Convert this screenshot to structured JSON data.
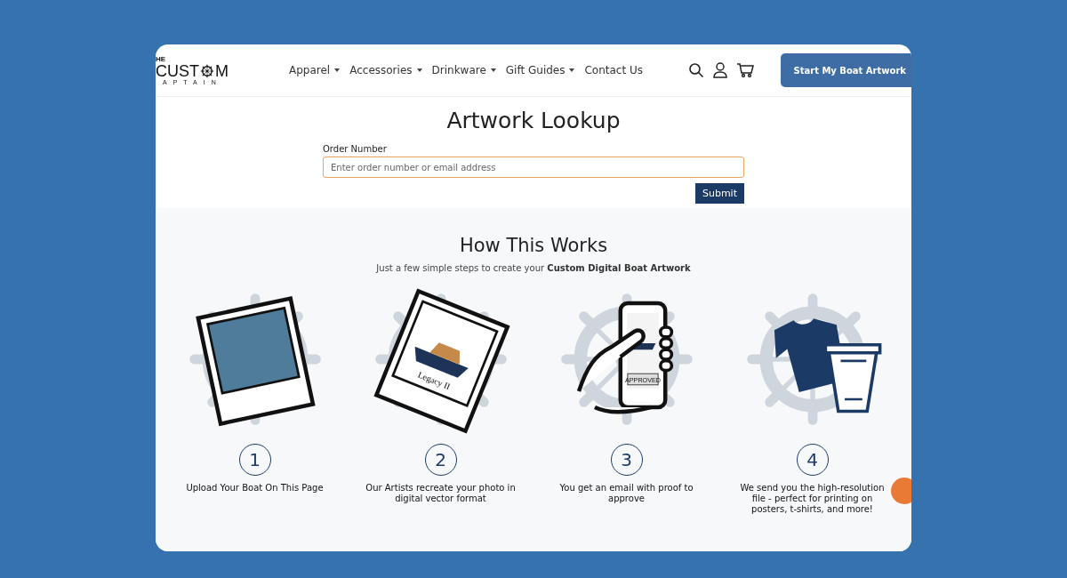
{
  "header": {
    "logo": {
      "top": "HE",
      "left": "CUST",
      "right": "M",
      "bottom": "APTAIN"
    },
    "nav": [
      {
        "label": "Apparel",
        "has_dropdown": true
      },
      {
        "label": "Accessories",
        "has_dropdown": true
      },
      {
        "label": "Drinkware",
        "has_dropdown": true
      },
      {
        "label": "Gift Guides",
        "has_dropdown": true
      },
      {
        "label": "Contact Us",
        "has_dropdown": false
      }
    ],
    "cta": "Start My Boat Artwork"
  },
  "lookup": {
    "title": "Artwork Lookup",
    "label": "Order Number",
    "placeholder": "Enter order number or email address",
    "submit": "Submit"
  },
  "how": {
    "title": "How This Works",
    "subtitle": "Just a few simple steps to create your **Custom Digital Boat Artwork**",
    "steps": [
      {
        "kind": "photo",
        "number": "1",
        "caption": "Upload Your Boat On This Page"
      },
      {
        "kind": "artwork",
        "number": "2",
        "caption": "Our Artists recreate your photo in digital vector format",
        "art_text": "Legacy II"
      },
      {
        "kind": "phone",
        "number": "3",
        "caption": "You get an email with proof to approve",
        "art_text": "APPROVED"
      },
      {
        "kind": "merch",
        "number": "4",
        "caption": "We send you the high-resolution file - perfect for printing on posters, t-shirts, and more!"
      }
    ]
  }
}
